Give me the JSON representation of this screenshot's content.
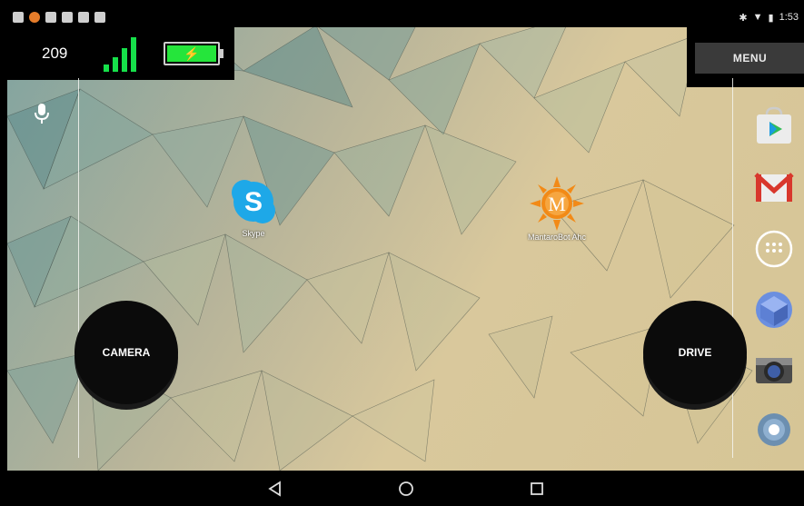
{
  "status_bar": {
    "time": "1:53",
    "notification_icons": [
      "calendar-icon",
      "app-icon",
      "image-icon",
      "email-icon",
      "download-icon",
      "clipboard-icon"
    ],
    "system_icons": [
      "bluetooth-icon",
      "wifi-icon",
      "battery-icon"
    ]
  },
  "hud": {
    "count": "209",
    "signal_level": 4,
    "battery_level": 1.0
  },
  "menu": {
    "label": "MENU"
  },
  "desktop": {
    "apps": [
      {
        "label": "Skype",
        "icon": "skype-icon"
      },
      {
        "label": "MantaroBot Ahc",
        "icon": "mantarobot-icon"
      }
    ]
  },
  "controls": {
    "camera_label": "CAMERA",
    "drive_label": "DRIVE"
  },
  "dock": [
    "play-store-icon",
    "gmail-icon",
    "app-drawer-icon",
    "cube-icon",
    "camera-icon",
    "settings-icon"
  ],
  "nav_bar": [
    "back-icon",
    "home-icon",
    "recents-icon"
  ],
  "colors": {
    "signal_green": "#16e04a",
    "battery_green": "#25e53b",
    "menu_bg": "#3a3a3a"
  }
}
